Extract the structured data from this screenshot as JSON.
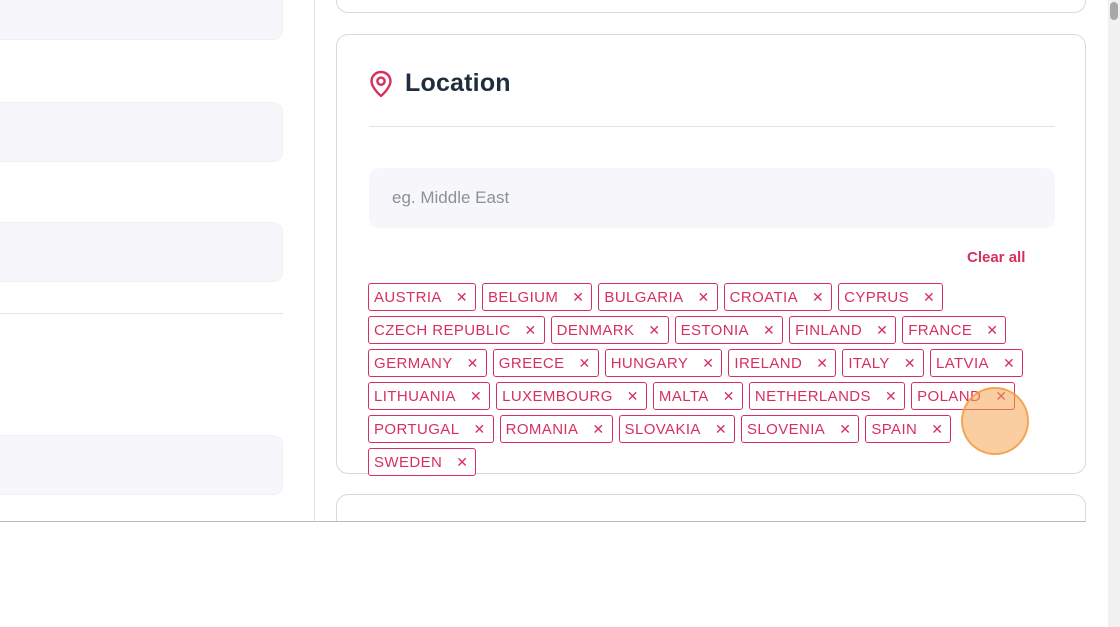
{
  "location": {
    "title": "Location",
    "search_placeholder": "eg. Middle East",
    "clear_all": "Clear all",
    "remove_glyph": "✕",
    "tags": [
      "AUSTRIA",
      "BELGIUM",
      "BULGARIA",
      "CROATIA",
      "CYPRUS",
      "CZECH REPUBLIC",
      "DENMARK",
      "ESTONIA",
      "FINLAND",
      "FRANCE",
      "GERMANY",
      "GREECE",
      "HUNGARY",
      "IRELAND",
      "ITALY",
      "LATVIA",
      "LITHUANIA",
      "LUXEMBOURG",
      "MALTA",
      "NETHERLANDS",
      "POLAND",
      "PORTUGAL",
      "ROMANIA",
      "SLOVAKIA",
      "SLOVENIA",
      "SPAIN",
      "SWEDEN"
    ]
  },
  "icons": {
    "location": "map-pin-icon",
    "remove": "close-icon"
  },
  "colors": {
    "accent": "#d6305f",
    "title": "#1f2d3d",
    "input_bg": "#f7f7fb",
    "border": "#d8d8de",
    "click_indicator": "#f5a654"
  }
}
